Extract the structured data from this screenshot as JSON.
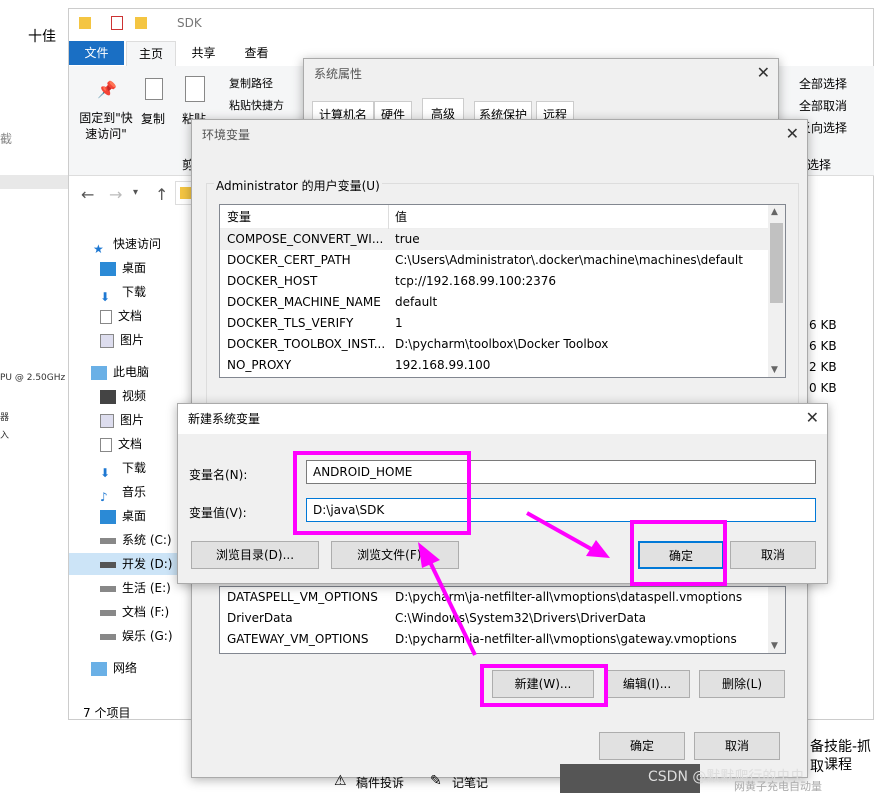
{
  "background": {
    "left_text": "十佳",
    "left_fragments": [
      "截",
      "PU @ 2.50GHz",
      "器",
      "入"
    ],
    "right_fragments": [
      "全部选择",
      "全部取消",
      "反向选择",
      "选择"
    ],
    "sizes": [
      "6 KB",
      "6 KB",
      "2 KB",
      "0 KB"
    ],
    "course_text": "备技能-抓取",
    "course_text2": "课程",
    "bottom_left": "稿件投诉",
    "bottom_left2": "记笔记",
    "watermark": "CSDN @默默爬行的虫虫",
    "watermark2": "网黄子充电自动量"
  },
  "explorer": {
    "title": "SDK",
    "tabs": [
      "文件",
      "主页",
      "共享",
      "查看"
    ],
    "ribbon": {
      "pin": "固定到\"快\n速访问\"",
      "copy": "复制",
      "paste": "粘贴",
      "copy_path": "复制路径",
      "paste_shortcut": "粘贴快捷方",
      "cut": "剪"
    },
    "nav": [
      "快速访问",
      "桌面",
      "下载",
      "文档",
      "图片",
      "此电脑",
      "视频",
      "图片",
      "文档",
      "下载",
      "音乐",
      "桌面",
      "系统 (C:)",
      "开发 (D:)",
      "生活 (E:)",
      "文档 (F:)",
      "娱乐 (G:)",
      "网络"
    ],
    "status": "7 个项目"
  },
  "sysprops": {
    "title": "系统属性",
    "tabs": [
      "计算机名",
      "硬件",
      "高级",
      "系统保护",
      "远程"
    ]
  },
  "envvars": {
    "title": "环境变量",
    "user_group": "Administrator 的用户变量(U)",
    "col_var": "变量",
    "col_val": "值",
    "user_vars": [
      {
        "name": "COMPOSE_CONVERT_WI...",
        "value": "true"
      },
      {
        "name": "DOCKER_CERT_PATH",
        "value": "C:\\Users\\Administrator\\.docker\\machine\\machines\\default"
      },
      {
        "name": "DOCKER_HOST",
        "value": "tcp://192.168.99.100:2376"
      },
      {
        "name": "DOCKER_MACHINE_NAME",
        "value": "default"
      },
      {
        "name": "DOCKER_TLS_VERIFY",
        "value": "1"
      },
      {
        "name": "DOCKER_TOOLBOX_INST...",
        "value": "D:\\pycharm\\toolbox\\Docker Toolbox"
      },
      {
        "name": "NO_PROXY",
        "value": "192.168.99.100"
      }
    ],
    "sys_vars": [
      {
        "name": "DATASPELL_VM_OPTIONS",
        "value": "D:\\pycharm\\ja-netfilter-all\\vmoptions\\dataspell.vmoptions"
      },
      {
        "name": "DriverData",
        "value": "C:\\Windows\\System32\\Drivers\\DriverData"
      },
      {
        "name": "GATEWAY_VM_OPTIONS",
        "value": "D:\\pycharm\\ja-netfilter-all\\vmoptions\\gateway.vmoptions"
      }
    ],
    "btn_new": "新建(W)...",
    "btn_edit": "编辑(I)...",
    "btn_delete": "删除(L)",
    "btn_ok": "确定",
    "btn_cancel": "取消"
  },
  "newvar": {
    "title": "新建系统变量",
    "name_label": "变量名(N):",
    "value_label": "变量值(V):",
    "name_value": "ANDROID_HOME",
    "value_value": "D:\\java\\SDK",
    "browse_dir": "浏览目录(D)...",
    "browse_file": "浏览文件(F)...",
    "ok": "确定",
    "cancel": "取消"
  },
  "colors": {
    "accent": "#0078d7",
    "highlight": "#ff00ff"
  }
}
